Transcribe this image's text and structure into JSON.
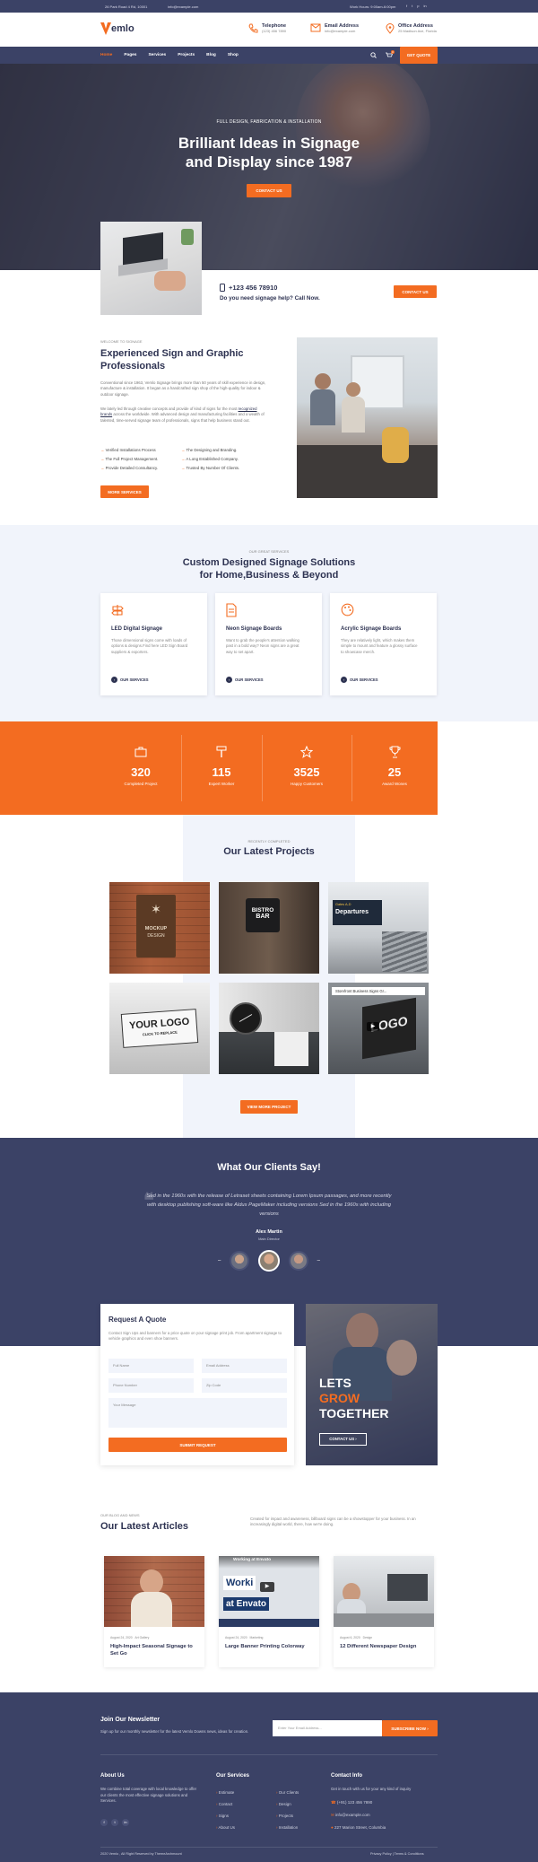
{
  "topbar": {
    "address": "26 Park Road 4 Rd, 10001",
    "email": "info@example.com",
    "hours": "Work Hours: 9:00am-6:00pm",
    "social": [
      "f",
      "t",
      "p",
      "in"
    ]
  },
  "header": {
    "logo": "emlo",
    "telephone_title": "Telephone",
    "telephone": "(123) 456 7890",
    "email_title": "Email Address",
    "email": "info@example.com",
    "office_title": "Office Address",
    "office": "25 Madison Ave, Florida"
  },
  "nav": {
    "items": [
      "Home",
      "Pages",
      "Services",
      "Projects",
      "Blog",
      "Shop"
    ],
    "cart_count": "0",
    "cta": "GET QUOTE"
  },
  "hero": {
    "eyebrow": "FULL DESIGN, FABRICATION & INSTALLATION",
    "title1": "Brilliant Ideas in Signage",
    "title2": "and Display since 1987",
    "cta": "CONTACT US"
  },
  "callbar": {
    "phone": "+123 456 78910",
    "text": "Do you need signage help? Call Now.",
    "cta": "CONTACT US"
  },
  "about": {
    "eyebrow": "WELCOME TO SIGNAGE",
    "title1": "Experienced Sign and Graphic",
    "title2": "Professionals",
    "p1": "Conventional since 1963, Vemlo Signage brings more than 50 years of skill experience in design, manufacture & installation. It began as a handcrafted sign shop of the high-quality for indoor & outdoor signage.",
    "p2a": "We lately led through creative concepts and provide of kind of signs for the most ",
    "p2link": "recognized brands",
    "p2b": " across the worldwide. With advanced design and manufacturing facilities and a wealth of talented, time-served signage team of professionals, signs that help business stand out.",
    "checks": [
      "Verified Installations Process",
      "The Designing and Branding.",
      "The Full Project Management.",
      "A Long Established Company.",
      "Provide Detailed Consultancy.",
      "Trusted By Number Of Clients."
    ],
    "cta": "MORE SERVICES"
  },
  "services": {
    "eyebrow": "OUR GREAT SERVICES",
    "title1": "Custom Designed Signage Solutions",
    "title2": "for Home,Business & Beyond",
    "items": [
      {
        "title": "LED Digital Signage",
        "text": "Those dimensional signs come with loads of options & designs.Find here LED Sign Board suppliers & exporters.",
        "link": "OUR SERVICES"
      },
      {
        "title": "Neon Signage Boards",
        "text": "Want to grab the people's attention walking past in a bold way? Neon signs are a great way to set apart.",
        "link": "OUR SERVICES"
      },
      {
        "title": "Acrylic Signage Boards",
        "text": "They are relatively light, which makes them simple to mount and feature a glossy surface to showcase merch.",
        "link": "OUR SERVICES"
      }
    ]
  },
  "stats": [
    {
      "value": "320",
      "label": "Completed Project"
    },
    {
      "value": "115",
      "label": "Expert Worker"
    },
    {
      "value": "3525",
      "label": "Happy Customers"
    },
    {
      "value": "25",
      "label": "Award Wones"
    }
  ],
  "projects": {
    "eyebrow": "RECENTLY COMPLETED",
    "title": "Our Latest Projects",
    "cta": "VIEW MORE PROJECT",
    "tiles": [
      {
        "line1": "MOCKUP",
        "line2": "DESIGN"
      },
      {
        "line1": "BISTRO",
        "line2": "BAR"
      },
      {
        "line1": "Departures",
        "line2": "Gates A-D"
      },
      {
        "line1": "YOUR LOGO",
        "line2": "CLICK TO REPLACE"
      },
      {
        "line1": "",
        "line2": ""
      },
      {
        "line1": "LOGO",
        "line2": "Storefront Business Signs Gr..."
      }
    ]
  },
  "testimonial": {
    "title": "What Our Clients Say!",
    "quote": "Sed in the 1960s with the release of Letraset sheets containing Lorem Ipsum passages, and more recently with desktop publishing soft-ware like Aldus PageMaker including versions Sed in the 1960s with including versions",
    "name": "Alex Martin",
    "role": "Main Director"
  },
  "quote": {
    "title": "Request A Quote",
    "text": "Contact Sign Ups and banners for a price quote on your signage print job. From apartment signage to vehicle graphics and even shoe banners.",
    "fields": [
      "Full Name",
      "Email Address",
      "Phone Number",
      "Zip Code",
      "Your Message"
    ],
    "cta": "SUBMIT REQUEST",
    "promo1": "LETS",
    "promo2": "GROW",
    "promo3": "TOGETHER",
    "promo_cta": "CONTACT US"
  },
  "articles": {
    "eyebrow": "OUR BLOG AND NEWS",
    "title": "Our Latest Articles",
    "intro": "Created for impact and awareness, billboard signs can be a showstopper for your business. In an increasingly digital world, there, how we're doing.",
    "items": [
      {
        "date": "August 24, 2020",
        "cat": "Art Gallery",
        "title": "High-Impact Seasonal Signage to Set Go"
      },
      {
        "date": "August 24, 2020",
        "cat": "Marketing",
        "title": "Large Banner Printing Colorway"
      },
      {
        "date": "August 6, 2020",
        "cat": "Design",
        "title": "12 Different Newspaper Design"
      }
    ],
    "video_title": "Working at Envato",
    "video_big1": "Worki",
    "video_big2": "at Envato"
  },
  "newsletter": {
    "title": "Join Our Newsletter",
    "text": "Sign up for our monthly newsletter for the latest Vemlo Downs news, ideas for creation.",
    "placeholder": "Enter Your Email Address...",
    "cta": "SUBSCRIBE NOW"
  },
  "footer": {
    "about_title": "About Us",
    "about_text": "We combine total coverage with local knowledge to offer our clients the most effective signage solutions and Services.",
    "services_title": "Our Services",
    "col1": [
      "Estimate",
      "Contact",
      "Signs",
      "About Us"
    ],
    "col2": [
      "Our Clients",
      "Design",
      "Projects",
      "Installation"
    ],
    "contact_title": "Contact Info",
    "contact_text": "Get in touch with us for your any kind of inquiry",
    "contact_phone": "(+91) 123 456 7890",
    "contact_email": "info@example.com",
    "contact_addr": "227 Marion Street, Columbia",
    "copyright": "2020 Vemlo , All Right Reserved by ThemeArchmount",
    "policy": "Privacy Policy",
    "terms": "Terms & Conditions"
  }
}
